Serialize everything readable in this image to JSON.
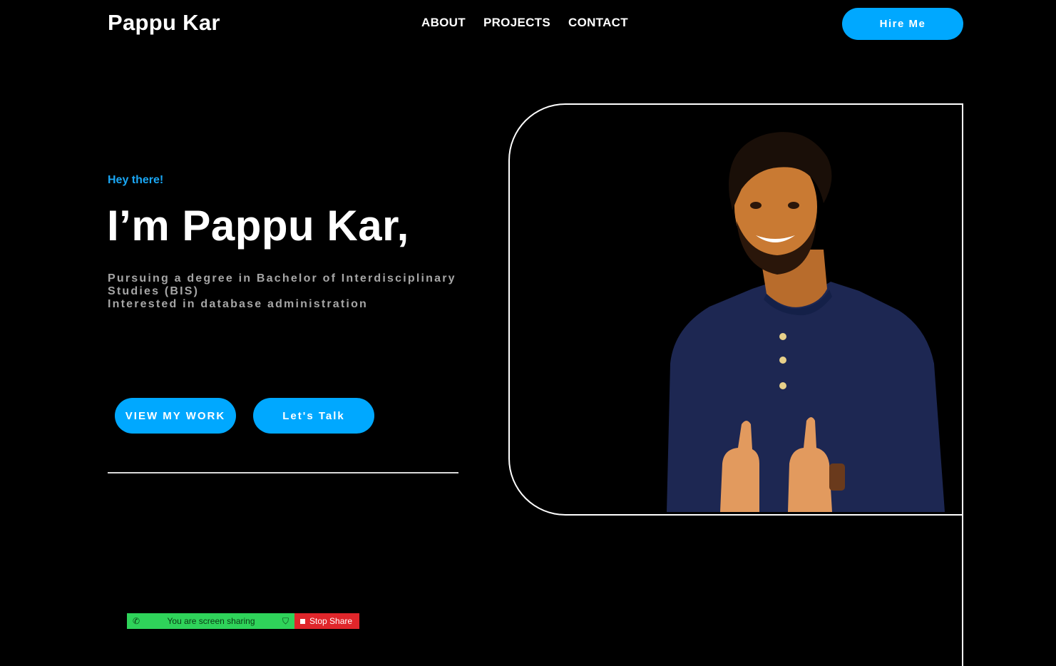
{
  "header": {
    "logo": "Pappu Kar",
    "nav": [
      {
        "label": "ABOUT"
      },
      {
        "label": "PROJECTS"
      },
      {
        "label": "CONTACT"
      }
    ],
    "cta_label": "Hire Me"
  },
  "hero": {
    "greeting": "Hey there!",
    "headline": "I’m Pappu Kar,",
    "bio_lines": [
      "Pursuing a degree in Bachelor of Interdisciplinary Studies (BIS)",
      "Interested in database administration"
    ],
    "buttons": {
      "primary": "VIEW MY WORK",
      "secondary": "Let's Talk"
    },
    "photo_icon": "person-thumbs-up-photo"
  },
  "screen_share": {
    "status": "You are screen sharing",
    "stop_label": "Stop Share",
    "icons": [
      "phone-icon",
      "shield-icon",
      "stop-icon"
    ]
  },
  "colors": {
    "background": "#000000",
    "accent": "#00a8ff",
    "greeting": "#1aa7f5",
    "bio_text": "#a6a6a6",
    "share_green": "#2fd35a",
    "share_red": "#e0262b"
  }
}
